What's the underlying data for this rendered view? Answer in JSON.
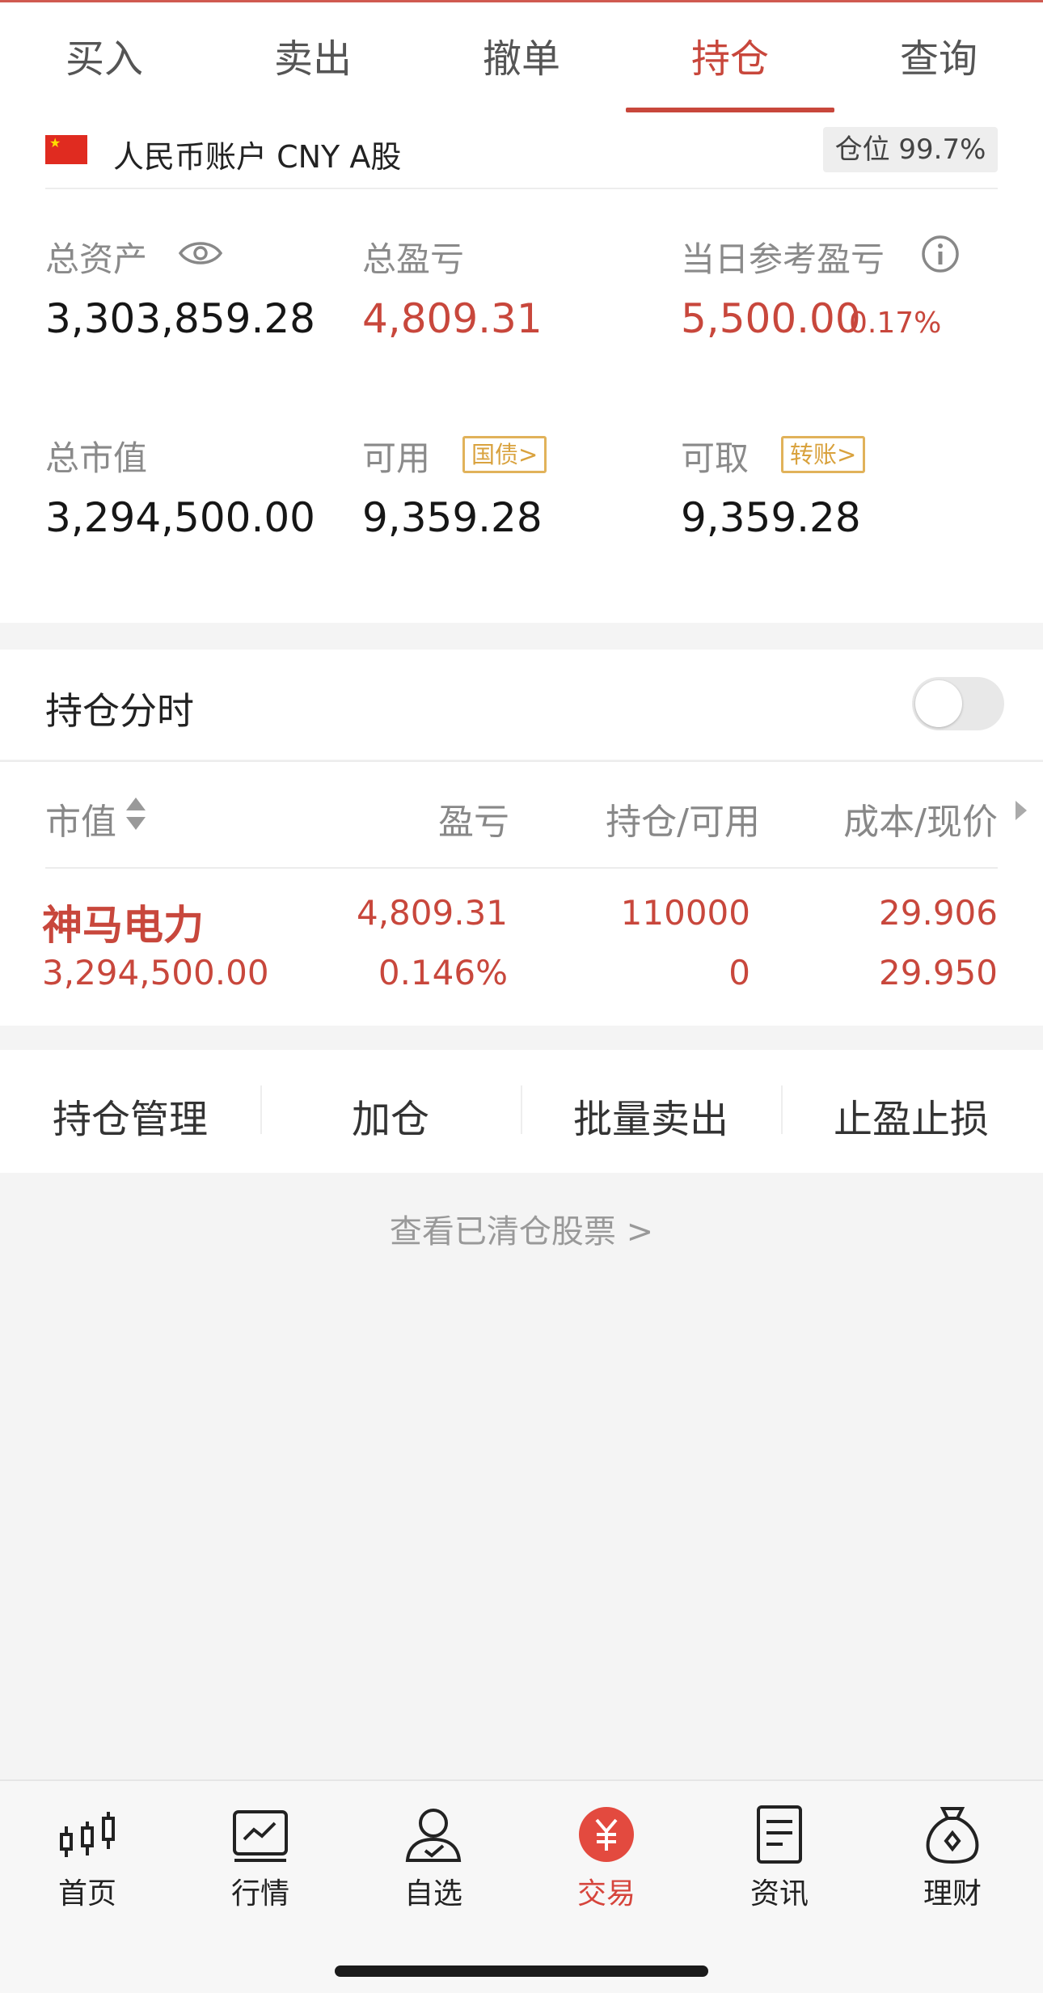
{
  "tabs": [
    {
      "label": "买入"
    },
    {
      "label": "卖出"
    },
    {
      "label": "撤单"
    },
    {
      "label": "持仓",
      "active": true
    },
    {
      "label": "查询"
    }
  ],
  "account": {
    "label": "人民币账户 CNY A股",
    "position_badge": "仓位 99.7%"
  },
  "summary": {
    "total_assets_label": "总资产",
    "total_assets": "3,303,859.28",
    "total_pl_label": "总盈亏",
    "total_pl": "4,809.31",
    "daily_pl_label": "当日参考盈亏",
    "daily_pl": "5,500.00",
    "daily_pl_pct": "0.17%",
    "market_value_label": "总市值",
    "market_value": "3,294,500.00",
    "available_label": "可用",
    "available_tag": "国债>",
    "available": "9,359.28",
    "withdrawable_label": "可取",
    "withdrawable_tag": "转账>",
    "withdrawable": "9,359.28"
  },
  "intraday": {
    "title": "持仓分时",
    "toggle_on": false
  },
  "table": {
    "headers": [
      "市值",
      "盈亏",
      "持仓/可用",
      "成本/现价"
    ],
    "rows": [
      {
        "name": "神马电力",
        "market_value": "3,294,500.00",
        "pl": "4,809.31",
        "pl_pct": "0.146%",
        "position": "110000",
        "available": "0",
        "cost": "29.906",
        "price": "29.950"
      }
    ]
  },
  "actions": [
    "持仓管理",
    "加仓",
    "批量卖出",
    "止盈止损"
  ],
  "cleared_link": "查看已清仓股票 >",
  "nav": [
    {
      "label": "首页",
      "icon": "candlestick-icon"
    },
    {
      "label": "行情",
      "icon": "chart-icon"
    },
    {
      "label": "自选",
      "icon": "user-check-icon"
    },
    {
      "label": "交易",
      "icon": "yuan-circle-icon",
      "active": true
    },
    {
      "label": "资讯",
      "icon": "document-icon"
    },
    {
      "label": "理财",
      "icon": "money-bag-icon"
    }
  ],
  "colors": {
    "accent": "#c8473c",
    "tag": "#d9a23e"
  }
}
